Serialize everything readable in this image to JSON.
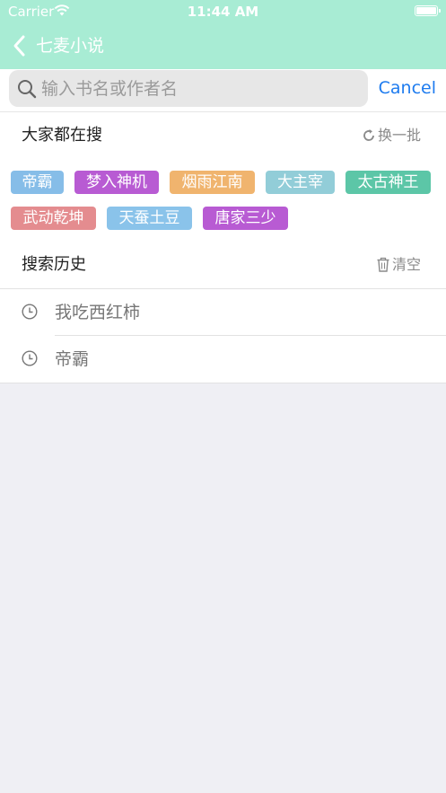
{
  "status_bar": {
    "carrier": "Carrier",
    "time": "11:44 AM",
    "battery_level": 1.0
  },
  "nav": {
    "title": "七麦小说",
    "back_icon": "chevron-left-icon"
  },
  "search": {
    "placeholder": "输入书名或作者名",
    "value": "",
    "cancel_label": "Cancel"
  },
  "hot": {
    "title": "大家都在搜",
    "refresh_label": "换一批",
    "tags": [
      {
        "label": "帝霸",
        "color": "#86bde8"
      },
      {
        "label": "梦入神机",
        "color": "#b85bd3"
      },
      {
        "label": "烟雨江南",
        "color": "#f0b46e"
      },
      {
        "label": "大主宰",
        "color": "#92cdd8"
      },
      {
        "label": "太古神王",
        "color": "#5cc6a7"
      },
      {
        "label": "武动乾坤",
        "color": "#e48c8f"
      },
      {
        "label": "天蚕土豆",
        "color": "#8ac3ea"
      },
      {
        "label": "唐家三少",
        "color": "#b85bd3"
      }
    ]
  },
  "history": {
    "title": "搜索历史",
    "clear_label": "清空",
    "items": [
      {
        "label": "我吃西红柿"
      },
      {
        "label": "帝霸"
      }
    ]
  }
}
